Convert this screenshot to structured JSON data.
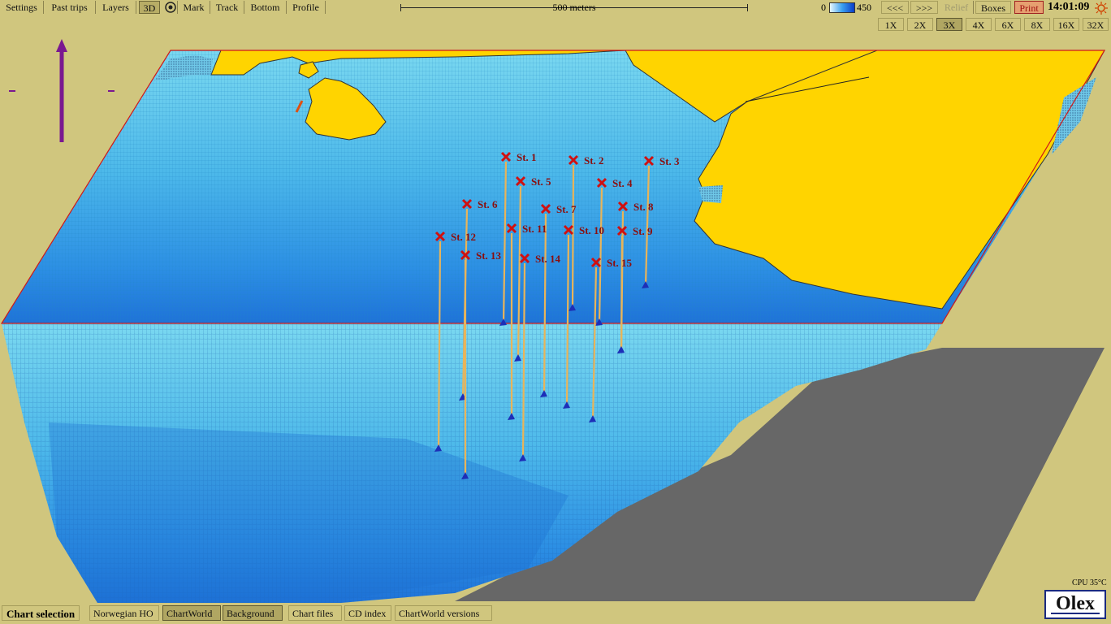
{
  "toolbar": {
    "settings": "Settings",
    "past_trips": "Past trips",
    "layers": "Layers",
    "three_d": "3D",
    "mark": "Mark",
    "track": "Track",
    "bottom": "Bottom",
    "profile": "Profile",
    "scale_label": "500 meters",
    "depth_min": "0",
    "depth_max": "450",
    "prev": "<<<",
    "next": ">>>",
    "relief": "Relief",
    "boxes": "Boxes",
    "print": "Print",
    "time": "14:01:09"
  },
  "zoom": [
    "1X",
    "2X",
    "3X",
    "4X",
    "6X",
    "8X",
    "16X",
    "32X"
  ],
  "zoom_selected": "3X",
  "stations": [
    {
      "label": "St. 1"
    },
    {
      "label": "St. 2"
    },
    {
      "label": "St. 3"
    },
    {
      "label": "St. 4"
    },
    {
      "label": "St. 5"
    },
    {
      "label": "St. 6"
    },
    {
      "label": "St. 7"
    },
    {
      "label": "St. 8"
    },
    {
      "label": "St. 9"
    },
    {
      "label": "St. 10"
    },
    {
      "label": "St. 11"
    },
    {
      "label": "St. 12"
    },
    {
      "label": "St. 13"
    },
    {
      "label": "St. 14"
    },
    {
      "label": "St. 15"
    }
  ],
  "status": {
    "cpu": "CPU 35°C",
    "logo": "Olex"
  },
  "bottom_bar": {
    "title": "Chart selection",
    "norwegian_ho": "Norwegian HO",
    "chartworld": "ChartWorld",
    "background": "Background",
    "chart_files": "Chart files",
    "cd_index": "CD index",
    "chartworld_versions": "ChartWorld versions"
  },
  "colors": {
    "background": "#d0c67e",
    "land": "#ffd400",
    "water_light": "#6fd2ee",
    "water_deep": "#1e7fe0",
    "grey_wall": "#666666",
    "marker_red": "#d01010",
    "station_line": "#e8b45a"
  }
}
